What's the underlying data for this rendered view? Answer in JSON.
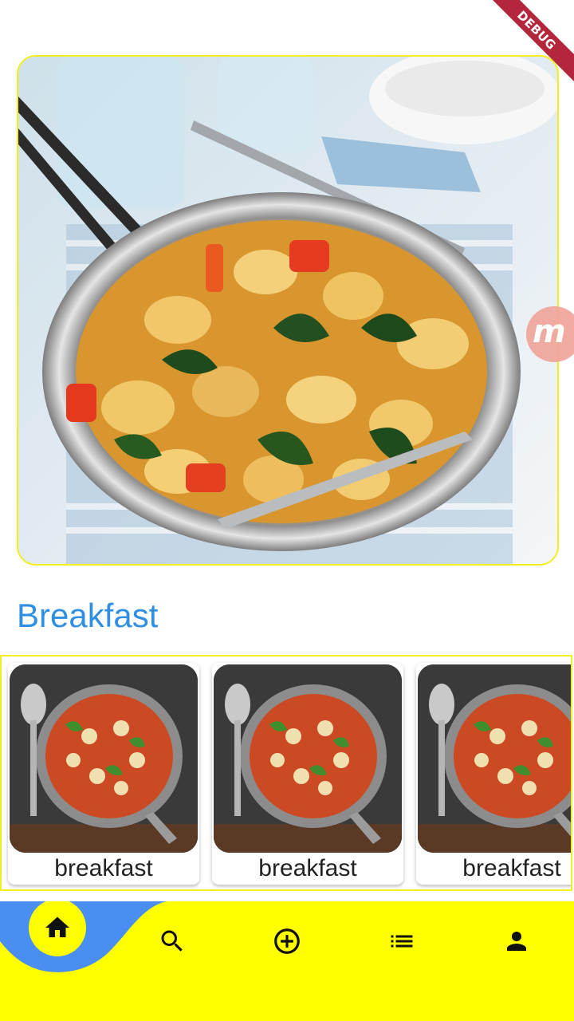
{
  "debug_banner": {
    "label": "DEBUG"
  },
  "hero": {
    "description_icon": "food-photo-icon"
  },
  "section": {
    "title": "Breakfast"
  },
  "recipes": [
    {
      "label": "breakfast",
      "icon": "food-photo-icon"
    },
    {
      "label": "breakfast",
      "icon": "food-photo-icon"
    },
    {
      "label": "breakfast",
      "icon": "food-photo-icon"
    }
  ],
  "bottom_nav": {
    "items": [
      {
        "icon": "home-icon",
        "active": true
      },
      {
        "icon": "search-icon",
        "active": false
      },
      {
        "icon": "add-circle-icon",
        "active": false
      },
      {
        "icon": "list-icon",
        "active": false
      },
      {
        "icon": "person-icon",
        "active": false
      }
    ]
  },
  "colors": {
    "accent": "#2f8fe0",
    "highlight": "#ffff00",
    "border": "#f2ef1e",
    "nav_blob": "#4a8ef2",
    "debug": "#b3263b"
  }
}
